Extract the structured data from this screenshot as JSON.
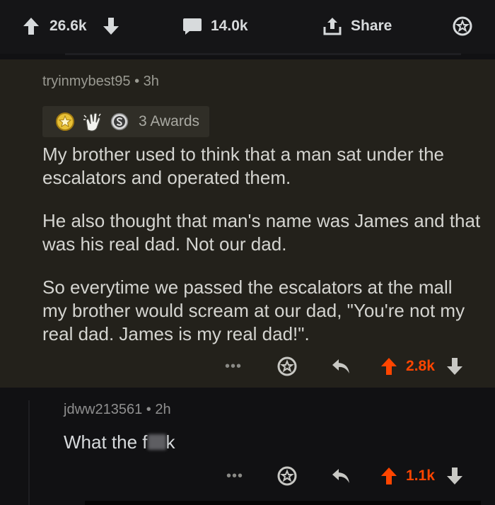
{
  "post_bar": {
    "upvotes": "26.6k",
    "comments": "14.0k",
    "share_label": "Share"
  },
  "comment": {
    "author": "tryinmybest95",
    "separator": "•",
    "age": "3h",
    "awards_label": "3 Awards",
    "paragraphs": [
      "My brother used to think that a man sat under the escalators and operated them.",
      "He also thought that man's name was James and that was his real dad. Not our dad.",
      "So everytime we passed the escalators at the mall my brother would scream at our dad, \"You're not my real dad. James is my real dad!\"."
    ],
    "more_label": "•••",
    "score": "2.8k"
  },
  "reply": {
    "author": "jdww213561",
    "separator": "•",
    "age": "2h",
    "body_start": "What the f",
    "body_end": "k",
    "more_label": "•••",
    "score": "1.1k"
  },
  "colors": {
    "upvoted": "#ff4500",
    "highlight_bg": "#23211b",
    "page_bg": "#111113"
  },
  "icons": [
    "arrow-up-icon",
    "arrow-down-icon",
    "comment-icon",
    "share-icon",
    "award-icon",
    "reply-icon",
    "gold-award-icon",
    "clapping-award-icon",
    "silver-award-icon"
  ]
}
